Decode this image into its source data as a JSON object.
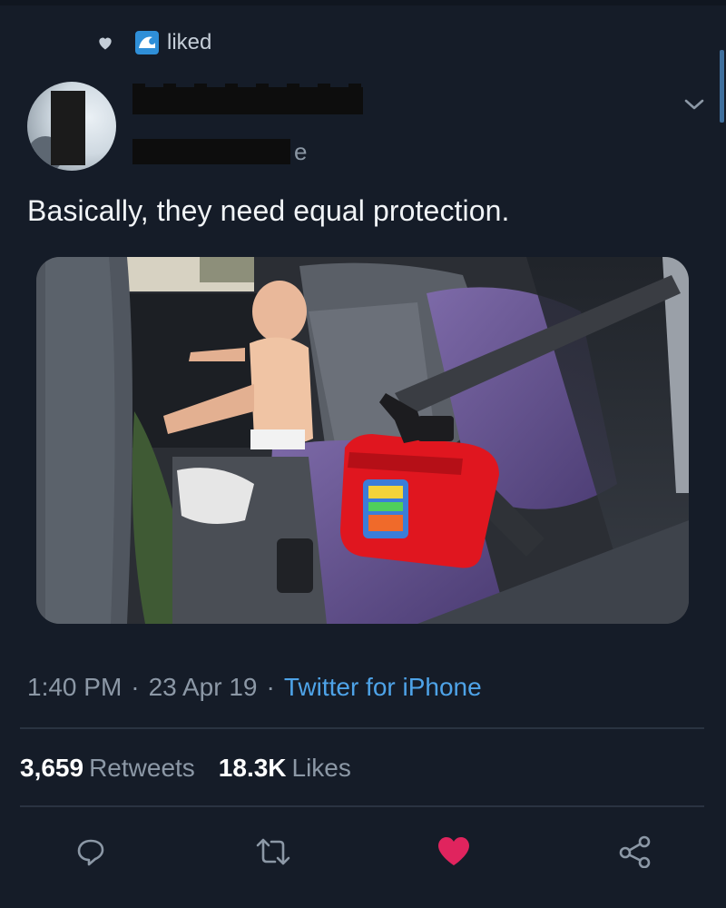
{
  "activity": {
    "label": "liked"
  },
  "tweet": {
    "text": "Basically, they need equal protection.",
    "handle_visible_tail": "e",
    "time": "1:40 PM",
    "date": "23 Apr 19",
    "source": "Twitter for iPhone",
    "separator": "·"
  },
  "stats": {
    "retweets_count": "3,659",
    "retweets_label": "Retweets",
    "likes_count": "18.3K",
    "likes_label": "Likes"
  },
  "actions": {
    "reply_icon": "reply-bubble-icon",
    "retweet_icon": "retweet-arrows-icon",
    "like_icon": "heart-icon",
    "share_icon": "share-icon"
  },
  "colors": {
    "background": "#151c28",
    "link": "#4ea3e8",
    "like_active": "#e0245e",
    "muted": "#8c98a6"
  }
}
